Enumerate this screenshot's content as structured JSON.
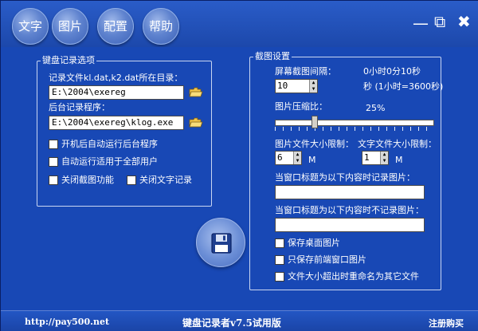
{
  "nav": [
    "文字",
    "图片",
    "配置",
    "帮助"
  ],
  "window_controls": {
    "minimize": "—",
    "restore": "⧉",
    "close": "✖"
  },
  "keyboard_group": {
    "legend": "键盘记录选项",
    "dir_label": "记录文件kl.dat,k2.dat所在目录：",
    "dir_value": "E:\\2004\\exereg",
    "program_label": "后台记录程序：",
    "program_value": "E:\\2004\\exereg\\klog.exe",
    "checkboxes": [
      "开机后自动运行后台程序",
      "自动运行适用于全部用户",
      "关闭截图功能",
      "关闭文字记录"
    ]
  },
  "screenshot_group": {
    "legend": "截图设置",
    "interval_label": "屏幕截图间隔：",
    "interval_readout": "0小时0分10秒",
    "interval_value": "10",
    "interval_note": "秒 (1小时=3600秒)",
    "compress_label": "图片压缩比：",
    "compress_value": "25%",
    "compress_fraction": 0.25,
    "image_limit_label": "图片文件大小限制：",
    "image_limit_value": "6",
    "image_limit_unit": "M",
    "text_limit_label": "文字文件大小限制：",
    "text_limit_value": "1",
    "text_limit_unit": "M",
    "record_title_label": "当窗口标题为以下内容时记录图片：",
    "record_title_value": "",
    "norecord_title_label": "当窗口标题为以下内容时不记录图片：",
    "norecord_title_value": "",
    "checkboxes": [
      "保存桌面图片",
      "只保存前端窗口图片",
      "文件大小超出时重命名为其它文件"
    ]
  },
  "footer": {
    "url": "http://pay500.net",
    "title": "键盘记录者v7.5试用版",
    "register": "注册购买"
  },
  "colors": {
    "background": "#1848b5",
    "accent": "#ffcc00"
  }
}
